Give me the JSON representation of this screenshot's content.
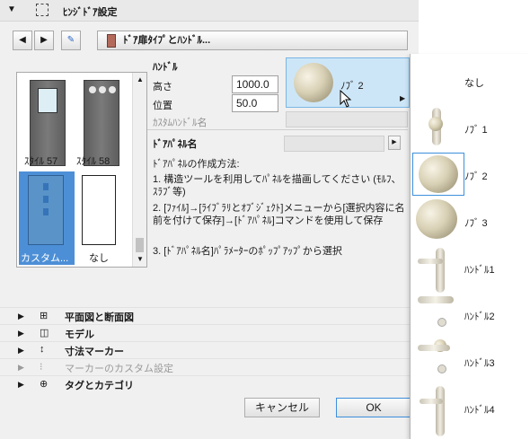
{
  "section": {
    "title": "ﾋﾝｼﾞﾄﾞｱ設定"
  },
  "toolbar": {
    "type_button_label": "ﾄﾞｱ扉ﾀｲﾌﾟとﾊﾝﾄﾞﾙ..."
  },
  "door_list": {
    "items": [
      {
        "label": "ｽﾀｲﾙ 57"
      },
      {
        "label": "ｽﾀｲﾙ 58"
      },
      {
        "label": "カスタム..."
      },
      {
        "label": "なし"
      }
    ],
    "selected": "カスタム..."
  },
  "handle": {
    "heading": "ﾊﾝﾄﾞﾙ",
    "height_label": "高さ",
    "height_value": "1000.0",
    "position_label": "位置",
    "position_value": "50.0",
    "custom_label": "ｶｽﾀﾑﾊﾝﾄﾞﾙ名",
    "selected_label": "ﾉﾌﾞ 2"
  },
  "door_panel": {
    "heading": "ﾄﾞｱﾊﾟﾈﾙ名",
    "help_title": "ﾄﾞｱﾊﾟﾈﾙの作成方法:",
    "step1": "1. 構造ツールを利用してﾊﾟﾈﾙを描画してください (ﾓﾙﾌ、ｽﾗﾌﾞ等)",
    "step2": "2. [ﾌｧｲﾙ]→[ﾗｲﾌﾞﾗﾘとｵﾌﾞｼﾞｪｸﾄ]メニューから[選択内容に名前を付けて保存]→[ﾄﾞｱﾊﾟﾈﾙ]コマンドを使用して保存",
    "step3": "3. [ﾄﾞｱﾊﾟﾈﾙ名]ﾊﾟﾗﾒｰﾀｰのﾎﾟｯﾌﾟｱｯﾌﾟから選択"
  },
  "sections": [
    {
      "label": "平面図と断面図",
      "enabled": true
    },
    {
      "label": "モデル",
      "enabled": true
    },
    {
      "label": "寸法マーカー",
      "enabled": true
    },
    {
      "label": "マーカーのカスタム設定",
      "enabled": false
    },
    {
      "label": "タグとカテゴリ",
      "enabled": true
    }
  ],
  "buttons": {
    "cancel": "キャンセル",
    "ok": "OK"
  },
  "popup": {
    "items": [
      {
        "label": "なし",
        "icon": "none"
      },
      {
        "label": "ﾉﾌﾞ 1",
        "icon": "knob-plate-icon"
      },
      {
        "label": "ﾉﾌﾞ 2",
        "icon": "knob-icon"
      },
      {
        "label": "ﾉﾌﾞ 3",
        "icon": "knob-rose-icon"
      },
      {
        "label": "ﾊﾝﾄﾞﾙ1",
        "icon": "lever-plate-icon"
      },
      {
        "label": "ﾊﾝﾄﾞﾙ2",
        "icon": "lever-icon"
      },
      {
        "label": "ﾊﾝﾄﾞﾙ3",
        "icon": "lever-rose-icon"
      },
      {
        "label": "ﾊﾝﾄﾞﾙ4",
        "icon": "lever-long-plate-icon"
      }
    ],
    "selected": "ﾉﾌﾞ 2"
  },
  "colors": {
    "selection": "#4d8fd6",
    "highlight": "#cde6f7",
    "popup_select_border": "#3c8fdd"
  }
}
